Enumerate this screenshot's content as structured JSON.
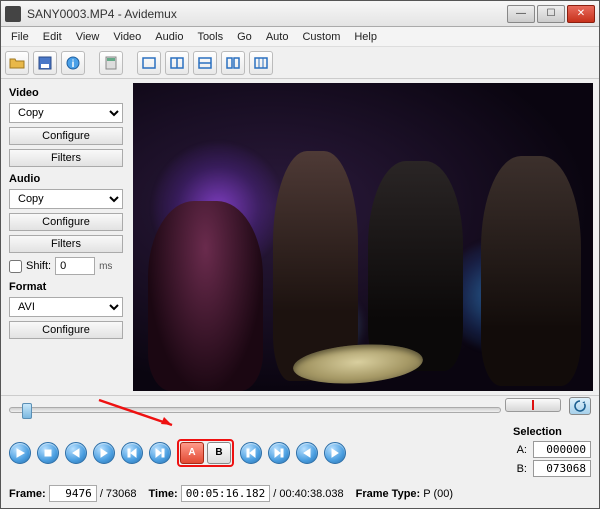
{
  "titlebar": {
    "title": "SANY0003.MP4 - Avidemux"
  },
  "menu": {
    "file": "File",
    "edit": "Edit",
    "view": "View",
    "video": "Video",
    "audio": "Audio",
    "tools": "Tools",
    "go": "Go",
    "auto": "Auto",
    "custom": "Custom",
    "help": "Help"
  },
  "sidebar": {
    "video_label": "Video",
    "video_codec": "Copy",
    "video_configure": "Configure",
    "video_filters": "Filters",
    "audio_label": "Audio",
    "audio_codec": "Copy",
    "audio_configure": "Configure",
    "audio_filters": "Filters",
    "shift_label": "Shift:",
    "shift_value": "0",
    "shift_unit": "ms",
    "format_label": "Format",
    "format_value": "AVI",
    "format_configure": "Configure"
  },
  "selection": {
    "header": "Selection",
    "a_label": "A:",
    "a_value": "000000",
    "b_label": "B:",
    "b_value": "073068"
  },
  "status": {
    "frame_label": "Frame:",
    "frame_current": "9476",
    "frame_total": "/ 73068",
    "time_label": "Time:",
    "time_current": "00:05:16.182",
    "time_total": "/ 00:40:38.038",
    "frametype_label": "Frame Type:",
    "frametype_value": "P (00)"
  },
  "marks": {
    "a": "A",
    "b": "B"
  }
}
